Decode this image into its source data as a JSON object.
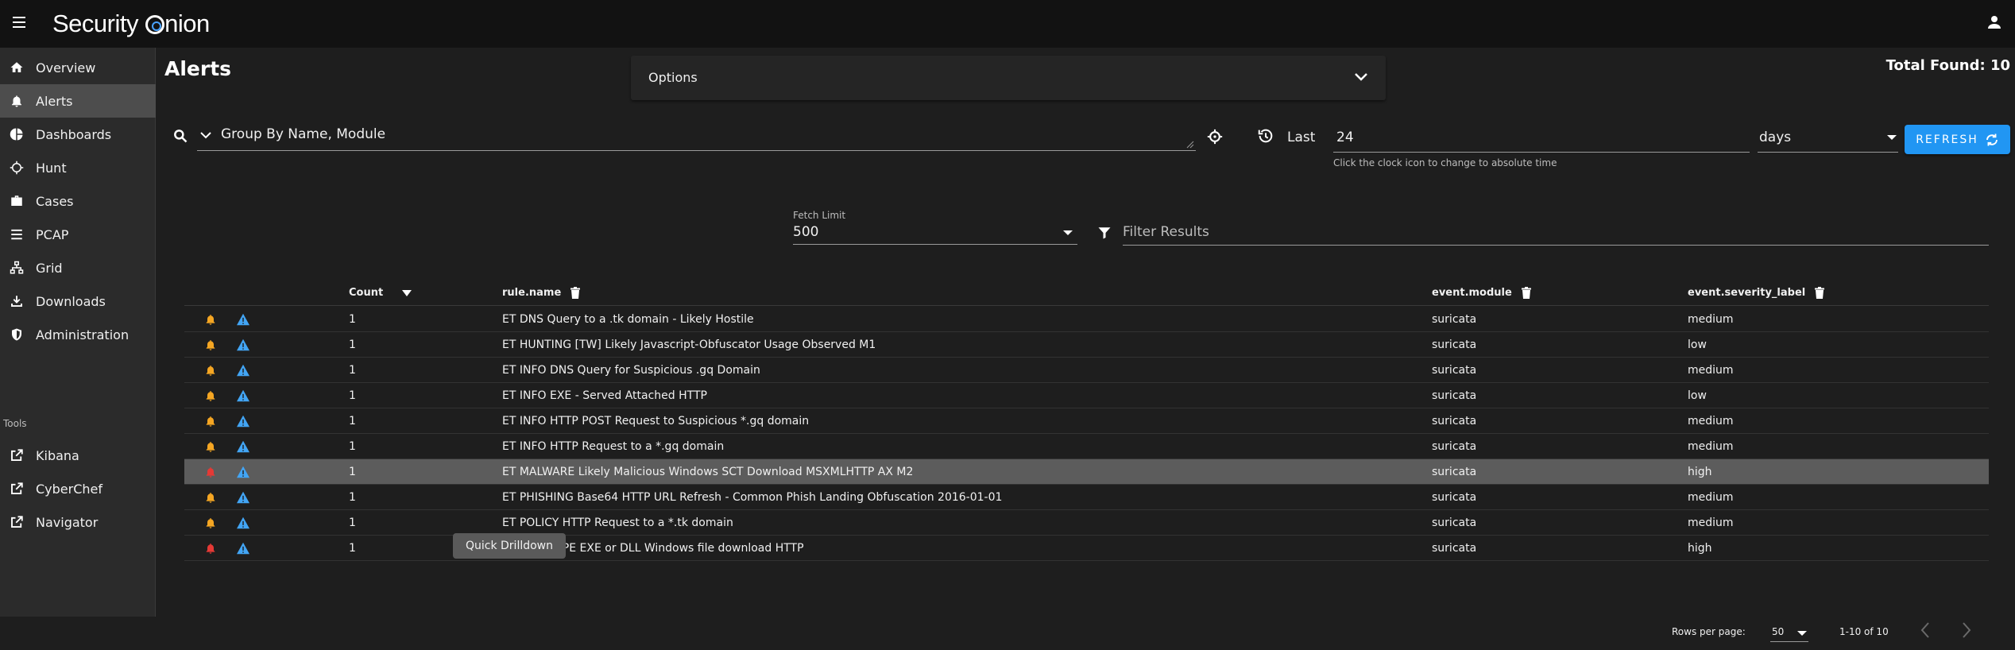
{
  "app": {
    "brand": "Security",
    "brand_suffix": "nion"
  },
  "colors": {
    "accent": "#2196f3",
    "bell_medium": "#f5a623",
    "bell_high": "#e53935",
    "warn": "#42a5f5",
    "active_nav": "#4d4d4d"
  },
  "sidebar": {
    "items": [
      {
        "label": "Overview",
        "icon": "home-icon"
      },
      {
        "label": "Alerts",
        "icon": "bell-icon",
        "active": true
      },
      {
        "label": "Dashboards",
        "icon": "pie-chart-icon"
      },
      {
        "label": "Hunt",
        "icon": "crosshairs-icon"
      },
      {
        "label": "Cases",
        "icon": "briefcase-icon"
      },
      {
        "label": "PCAP",
        "icon": "list-icon"
      },
      {
        "label": "Grid",
        "icon": "network-icon"
      },
      {
        "label": "Downloads",
        "icon": "download-icon"
      },
      {
        "label": "Administration",
        "icon": "shield-icon"
      }
    ],
    "tools_label": "Tools",
    "tools": [
      {
        "label": "Kibana",
        "icon": "external-link-icon"
      },
      {
        "label": "CyberChef",
        "icon": "external-link-icon"
      },
      {
        "label": "Navigator",
        "icon": "external-link-icon"
      }
    ]
  },
  "main": {
    "title": "Alerts",
    "total_found": "Total Found: 10",
    "options_label": "Options",
    "query": "Group By Name, Module",
    "last_label": "Last",
    "last_value": "24",
    "time_hint": "Click the clock icon to change to absolute time",
    "time_unit": "days",
    "refresh_label": "REFRESH",
    "fetch_limit_label": "Fetch Limit",
    "fetch_limit_value": "500",
    "filter_placeholder": "Filter Results"
  },
  "table": {
    "columns": {
      "count": "Count",
      "rule": "rule.name",
      "module": "event.module",
      "severity": "event.severity_label"
    },
    "rows": [
      {
        "count": "1",
        "rule": "ET DNS Query to a .tk domain - Likely Hostile",
        "module": "suricata",
        "severity": "medium"
      },
      {
        "count": "1",
        "rule": "ET HUNTING [TW] Likely Javascript-Obfuscator Usage Observed M1",
        "module": "suricata",
        "severity": "low"
      },
      {
        "count": "1",
        "rule": "ET INFO DNS Query for Suspicious .gq Domain",
        "module": "suricata",
        "severity": "medium"
      },
      {
        "count": "1",
        "rule": "ET INFO EXE - Served Attached HTTP",
        "module": "suricata",
        "severity": "low"
      },
      {
        "count": "1",
        "rule": "ET INFO HTTP POST Request to Suspicious *.gq domain",
        "module": "suricata",
        "severity": "medium"
      },
      {
        "count": "1",
        "rule": "ET INFO HTTP Request to a *.gq domain",
        "module": "suricata",
        "severity": "medium"
      },
      {
        "count": "1",
        "rule": "ET MALWARE Likely Malicious Windows SCT Download MSXMLHTTP AX M2",
        "module": "suricata",
        "severity": "high",
        "highlighted": true
      },
      {
        "count": "1",
        "rule": "ET PHISHING Base64 HTTP URL Refresh - Common Phish Landing Obfuscation 2016-01-01",
        "module": "suricata",
        "severity": "medium"
      },
      {
        "count": "1",
        "rule": "ET POLICY HTTP Request to a *.tk domain",
        "module": "suricata",
        "severity": "medium"
      },
      {
        "count": "1",
        "rule": "ET POLICY PE EXE or DLL Windows file download HTTP",
        "module": "suricata",
        "severity": "high"
      }
    ],
    "tooltip": "Quick Drilldown"
  },
  "footer": {
    "rows_per_page_label": "Rows per page:",
    "rows_per_page_value": "50",
    "range": "1-10 of 10"
  }
}
